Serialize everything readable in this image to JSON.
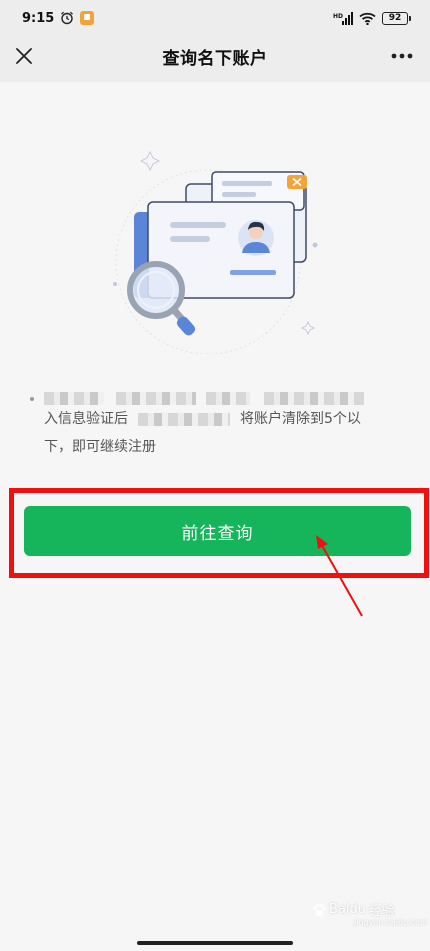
{
  "status_bar": {
    "time": "9:15",
    "network_label": "HD",
    "battery": "92",
    "icons": [
      "alarm-icon",
      "app-notification-icon",
      "signal-icon",
      "wifi-icon",
      "battery-icon"
    ]
  },
  "nav": {
    "title": "查询名下账户",
    "close_icon": "close-icon",
    "more_icon": "more-icon"
  },
  "notice": {
    "line2_start": "入信息验证后",
    "line2_end": "将账户清除到5个以",
    "line3": "下，即可继续注册"
  },
  "action": {
    "button_label": "前往查询",
    "button_color": "#16b45b",
    "highlight_color": "#ef1010"
  },
  "watermark": {
    "brand": "Baidu",
    "suffix": "经验",
    "sub": "jingyan.baidu.com"
  }
}
